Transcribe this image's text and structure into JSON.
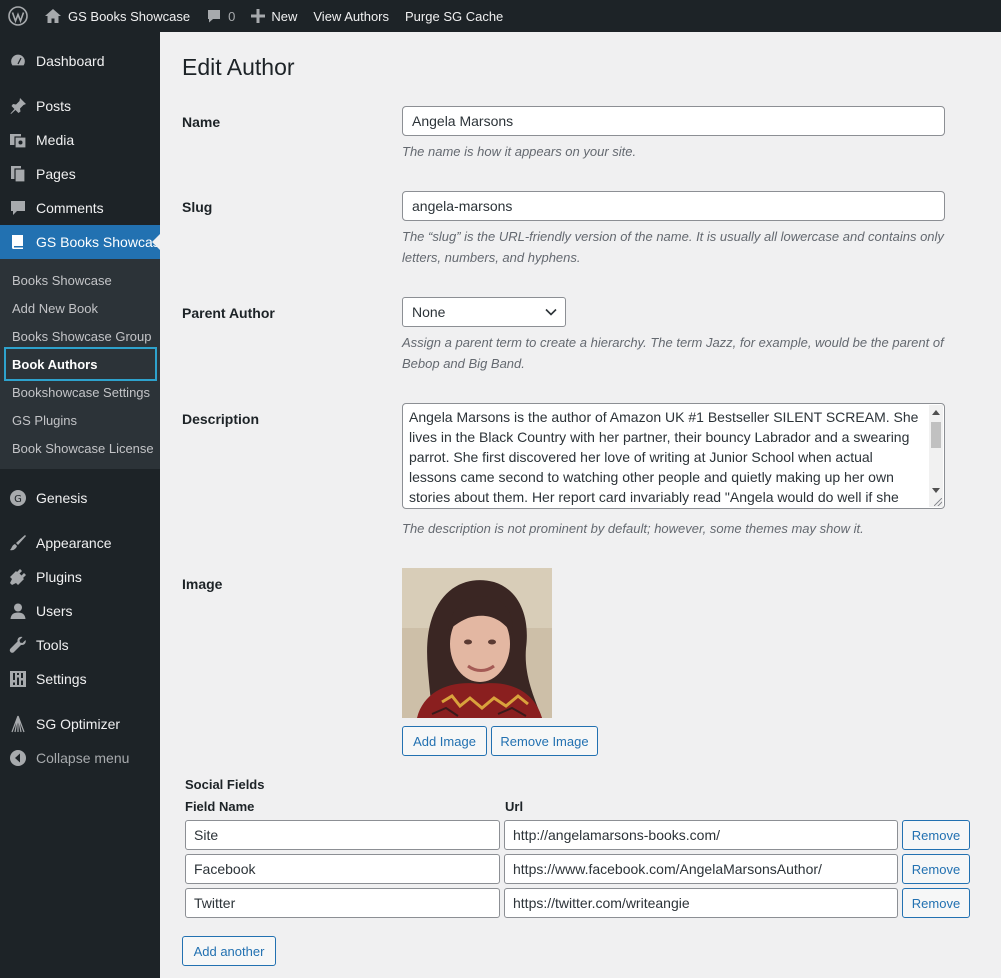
{
  "adminbar": {
    "site_name": "GS Books Showcase",
    "comments_count": "0",
    "new_label": "New",
    "view_authors": "View Authors",
    "purge_cache": "Purge SG Cache"
  },
  "sidebar": {
    "items": [
      {
        "label": "Dashboard",
        "icon": "dashboard-icon"
      },
      {
        "label": "Posts",
        "icon": "pin-icon"
      },
      {
        "label": "Media",
        "icon": "media-icon"
      },
      {
        "label": "Pages",
        "icon": "pages-icon"
      },
      {
        "label": "Comments",
        "icon": "comment-icon"
      },
      {
        "label": "GS Books Showcase",
        "icon": "book-icon"
      },
      {
        "label": "Genesis",
        "icon": "genesis-icon"
      },
      {
        "label": "Appearance",
        "icon": "brush-icon"
      },
      {
        "label": "Plugins",
        "icon": "plugin-icon"
      },
      {
        "label": "Users",
        "icon": "user-icon"
      },
      {
        "label": "Tools",
        "icon": "wrench-icon"
      },
      {
        "label": "Settings",
        "icon": "settings-icon"
      },
      {
        "label": "SG Optimizer",
        "icon": "sg-optimizer-icon"
      },
      {
        "label": "Collapse menu",
        "icon": "collapse-icon"
      }
    ],
    "submenu": [
      "Books Showcase",
      "Add New Book",
      "Books Showcase Group",
      "Book Authors",
      "Bookshowcase Settings",
      "GS Plugins",
      "Book Showcase License"
    ]
  },
  "page": {
    "title": "Edit Author",
    "name_label": "Name",
    "name_value": "Angela Marsons",
    "name_help": "The name is how it appears on your site.",
    "slug_label": "Slug",
    "slug_value": "angela-marsons",
    "slug_help": "The “slug” is the URL-friendly version of the name. It is usually all lowercase and contains only letters, numbers, and hyphens.",
    "parent_label": "Parent Author",
    "parent_value": "None",
    "parent_help": "Assign a parent term to create a hierarchy. The term Jazz, for example, would be the parent of Bebop and Big Band.",
    "description_label": "Description",
    "description_value": "Angela Marsons is the author of Amazon UK #1 Bestseller SILENT SCREAM. She lives in the Black Country with her partner, their bouncy Labrador and a swearing parrot. She first discovered her love of writing at Junior School when actual lessons came second to watching other people and quietly making up her own stories about them. Her report card invariably read \"Angela would do well if she minded",
    "description_help": "The description is not prominent by default; however, some themes may show it.",
    "image_label": "Image",
    "add_image": "Add Image",
    "remove_image": "Remove Image"
  },
  "social": {
    "title": "Social Fields",
    "col_field": "Field Name",
    "col_url": "Url",
    "rows": [
      {
        "name": "Site",
        "url": "http://angelamarsons-books.com/",
        "remove": "Remove"
      },
      {
        "name": "Facebook",
        "url": "https://www.facebook.com/AngelaMarsonsAuthor/",
        "remove": "Remove"
      },
      {
        "name": "Twitter",
        "url": "https://twitter.com/writeangie",
        "remove": "Remove"
      }
    ],
    "add_another": "Add another"
  },
  "colors": {
    "admin_dark": "#1d2327",
    "submenu_bg": "#2c3338",
    "accent_blue": "#2271b1",
    "focus_outline": "#2ea2cc",
    "page_bg": "#f0f0f1"
  }
}
